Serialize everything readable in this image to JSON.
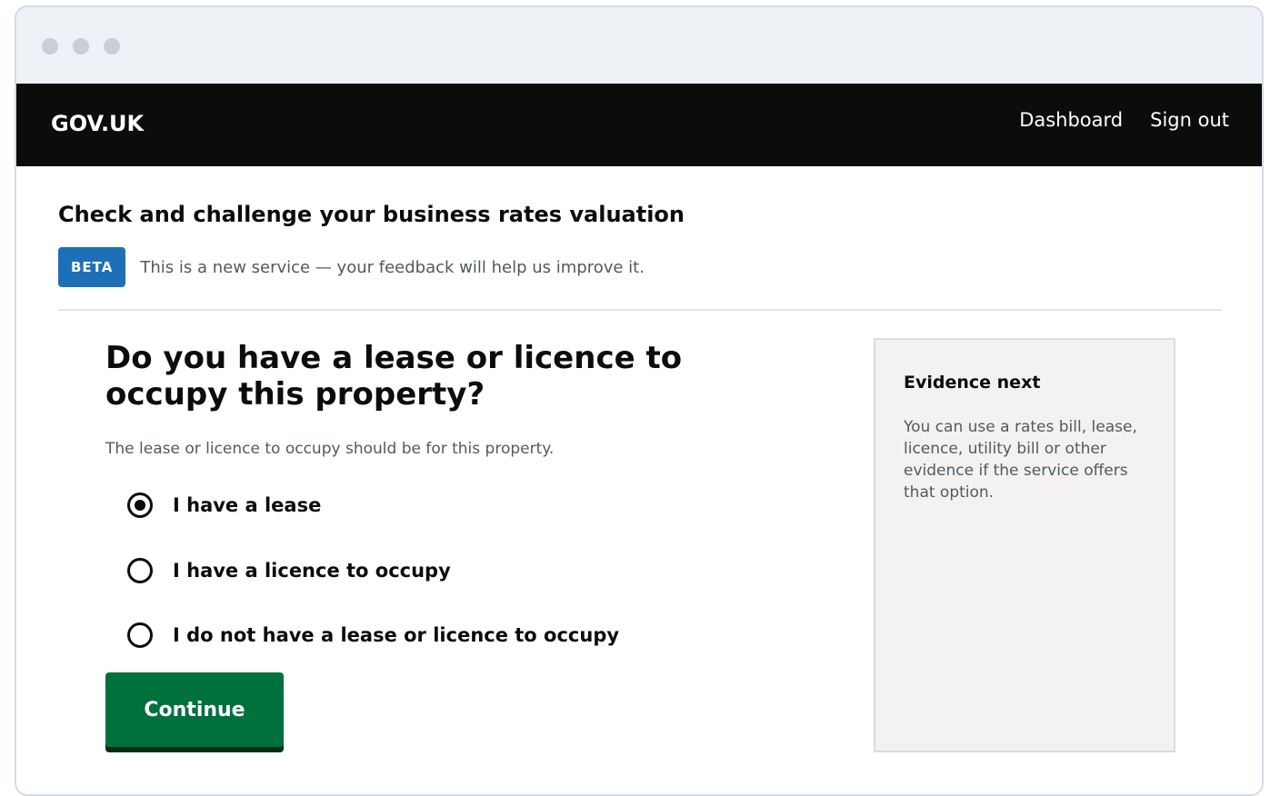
{
  "header": {
    "logo": "GOV.UK",
    "nav": [
      "Dashboard",
      "Sign out"
    ]
  },
  "service": {
    "name": "Check and challenge your business rates valuation",
    "phase_tag": "BETA",
    "phase_text": "This is a new service — your feedback will help us improve it."
  },
  "form": {
    "question": "Do you have a lease or licence to occupy this property?",
    "hint": "The lease or licence to occupy should be for this property.",
    "options": [
      {
        "label": "I have a lease",
        "checked": true
      },
      {
        "label": "I have a licence to occupy",
        "checked": false
      },
      {
        "label": "I do not have a lease or licence to occupy",
        "checked": false
      }
    ],
    "submit_label": "Continue"
  },
  "aside": {
    "title": "Evidence next",
    "body": "You can use a rates bill, lease, licence, utility bill or other evidence if the service offers that option."
  },
  "colors": {
    "header_bg": "#0b0c0c",
    "beta_tag": "#1d70b8",
    "button": "#00703c",
    "aside_bg": "#f3f2f1"
  }
}
